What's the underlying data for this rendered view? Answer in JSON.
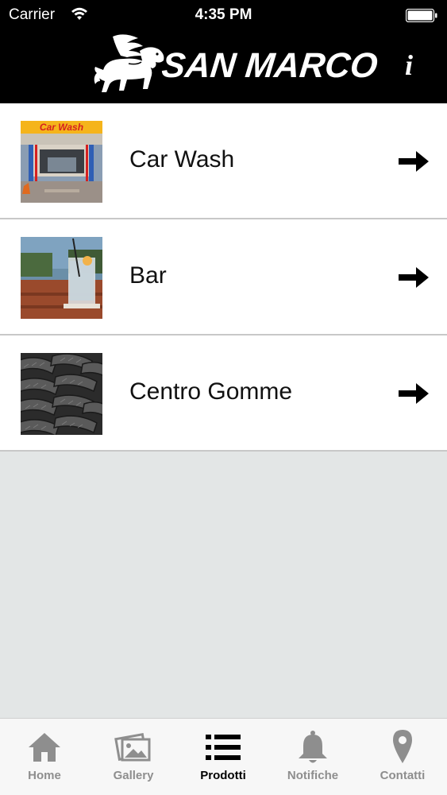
{
  "status_bar": {
    "carrier": "Carrier",
    "time": "4:35 PM"
  },
  "header": {
    "brand": "SAN MARCO",
    "info_label": "i"
  },
  "list": {
    "items": [
      {
        "label": "Car Wash",
        "thumb_caption": "Car Wash",
        "icon": "arrow-right-icon"
      },
      {
        "label": "Bar",
        "icon": "arrow-right-icon"
      },
      {
        "label": "Centro Gomme",
        "icon": "arrow-right-icon"
      }
    ]
  },
  "tabbar": {
    "active": "Prodotti",
    "tabs": [
      {
        "label": "Home",
        "icon": "home-icon"
      },
      {
        "label": "Gallery",
        "icon": "gallery-icon"
      },
      {
        "label": "Prodotti",
        "icon": "list-icon"
      },
      {
        "label": "Notifiche",
        "icon": "bell-icon"
      },
      {
        "label": "Contatti",
        "icon": "location-pin-icon"
      }
    ]
  },
  "colors": {
    "header_bg": "#000000",
    "list_bg": "#ffffff",
    "page_bg": "#e3e6e6",
    "tab_inactive": "#8e8e8e",
    "tab_active": "#000000",
    "car_wash_banner": "#f5b41b",
    "car_wash_banner_text": "#d62020"
  }
}
